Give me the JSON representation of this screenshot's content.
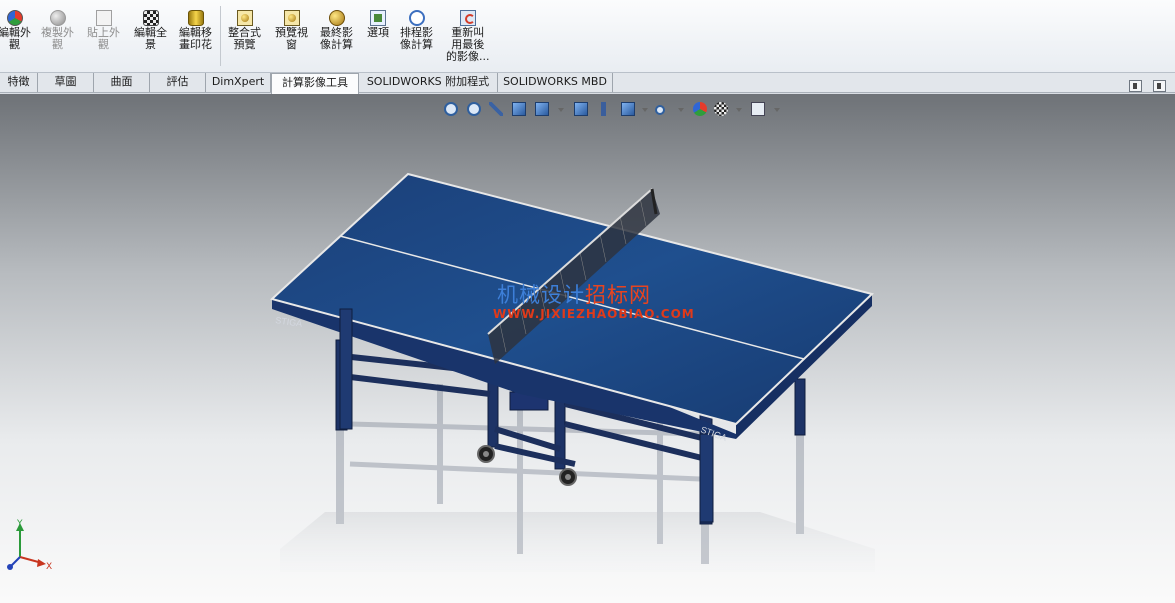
{
  "ribbon": {
    "buttons": [
      {
        "label": "編輯外\n觀",
        "icon": "appearance-icon",
        "enabled": true
      },
      {
        "label": "複製外\n觀",
        "icon": "copy-appearance-icon",
        "enabled": false
      },
      {
        "label": "貼上外\n觀",
        "icon": "paste-appearance-icon",
        "enabled": false
      },
      {
        "label": "編輯全\n景",
        "icon": "scene-icon",
        "enabled": true
      },
      {
        "label": "編輯移\n畫印花",
        "icon": "decal-icon",
        "enabled": true
      },
      {
        "label": "整合式\n預覽",
        "icon": "integrated-preview-icon",
        "enabled": true
      },
      {
        "label": "預覽視\n窗",
        "icon": "preview-window-icon",
        "enabled": true
      },
      {
        "label": "最終影\n像計算",
        "icon": "final-render-icon",
        "enabled": true
      },
      {
        "label": "選項",
        "icon": "options-icon",
        "enabled": true
      },
      {
        "label": "排程影\n像計算",
        "icon": "schedule-render-icon",
        "enabled": true
      },
      {
        "label": "重新叫\n用最後\n的影像...",
        "icon": "recall-last-image-icon",
        "enabled": true
      }
    ]
  },
  "tabs": {
    "items": [
      {
        "label": "特徵",
        "active": false
      },
      {
        "label": "草圖",
        "active": false
      },
      {
        "label": "曲面",
        "active": false
      },
      {
        "label": "評估",
        "active": false
      },
      {
        "label": "DimXpert",
        "active": false
      },
      {
        "label": "計算影像工具",
        "active": true
      },
      {
        "label": "SOLIDWORKS 附加程式",
        "active": false
      },
      {
        "label": "SOLIDWORKS MBD",
        "active": false
      }
    ]
  },
  "viewport": {
    "watermark_cn_part1": "机械设计",
    "watermark_cn_part2": "招标网",
    "watermark_url": "WWW.JIXIEZHAOBIAO.COM",
    "table_brand": "STIGA",
    "triad": {
      "y": "Y",
      "x": "X"
    }
  },
  "colors": {
    "table_top": "#1e4a86",
    "frame": "#1c2f5c",
    "ribbon_bg": "#eef1f5"
  }
}
